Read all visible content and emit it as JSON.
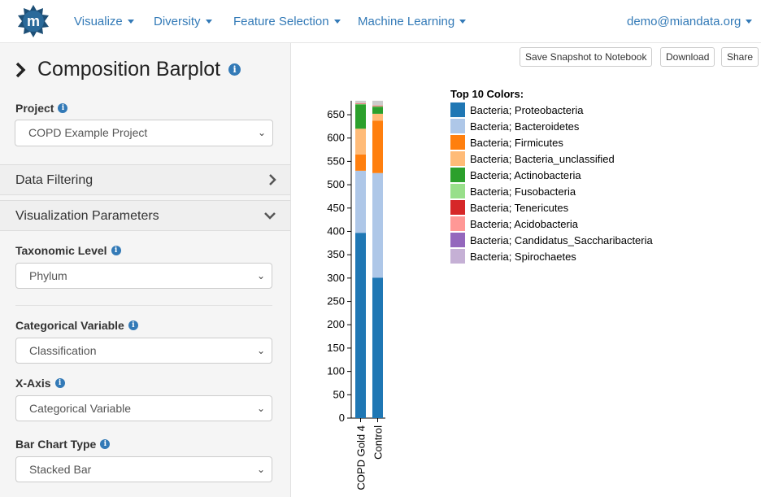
{
  "nav": {
    "items": [
      {
        "label": "Visualize"
      },
      {
        "label": "Diversity"
      },
      {
        "label": "Feature Selection"
      },
      {
        "label": "Machine Learning"
      }
    ],
    "user": "demo@miandata.org"
  },
  "panel": {
    "title": "Composition Barplot",
    "project_label": "Project",
    "project_value": "COPD Example Project",
    "data_filtering": "Data Filtering",
    "viz_params": "Visualization Parameters",
    "tax_level_label": "Taxonomic Level",
    "tax_level_value": "Phylum",
    "cat_var_label": "Categorical Variable",
    "cat_var_value": "Classification",
    "xaxis_label": "X-Axis",
    "xaxis_value": "Categorical Variable",
    "bar_type_label": "Bar Chart Type",
    "bar_type_value": "Stacked Bar"
  },
  "toolbar": {
    "snapshot": "Save Snapshot to Notebook",
    "download": "Download",
    "share": "Share"
  },
  "chart_data": {
    "type": "bar",
    "stacked": true,
    "categories": [
      "COPD Gold 4",
      "Control"
    ],
    "ylim": [
      0,
      680
    ],
    "yticks": [
      0,
      50,
      100,
      150,
      200,
      250,
      300,
      350,
      400,
      450,
      500,
      550,
      600,
      650
    ],
    "legend_title": "Top 10 Colors:",
    "series": [
      {
        "name": "Bacteria; Proteobacteria",
        "color": "#1f77b4",
        "values": [
          397,
          301
        ]
      },
      {
        "name": "Bacteria; Bacteroidetes",
        "color": "#aec7e8",
        "values": [
          133,
          224
        ]
      },
      {
        "name": "Bacteria; Firmicutes",
        "color": "#ff7f0e",
        "values": [
          35,
          112
        ]
      },
      {
        "name": "Bacteria; Bacteria_unclassified",
        "color": "#ffbb78",
        "values": [
          55,
          15
        ]
      },
      {
        "name": "Bacteria; Actinobacteria",
        "color": "#2ca02c",
        "values": [
          52,
          15
        ]
      },
      {
        "name": "Bacteria; Fusobacteria",
        "color": "#98df8a",
        "values": [
          1,
          1
        ]
      },
      {
        "name": "Bacteria; Tenericutes",
        "color": "#d62728",
        "values": [
          1,
          1
        ]
      },
      {
        "name": "Bacteria; Acidobacteria",
        "color": "#ff9896",
        "values": [
          1,
          1
        ]
      },
      {
        "name": "Bacteria; Candidatus_Saccharibacteria",
        "color": "#9467bd",
        "values": [
          0,
          0
        ]
      },
      {
        "name": "Bacteria; Spirochaetes",
        "color": "#c5b0d5",
        "values": [
          0,
          0
        ]
      }
    ],
    "other_color": "#cccccc"
  }
}
